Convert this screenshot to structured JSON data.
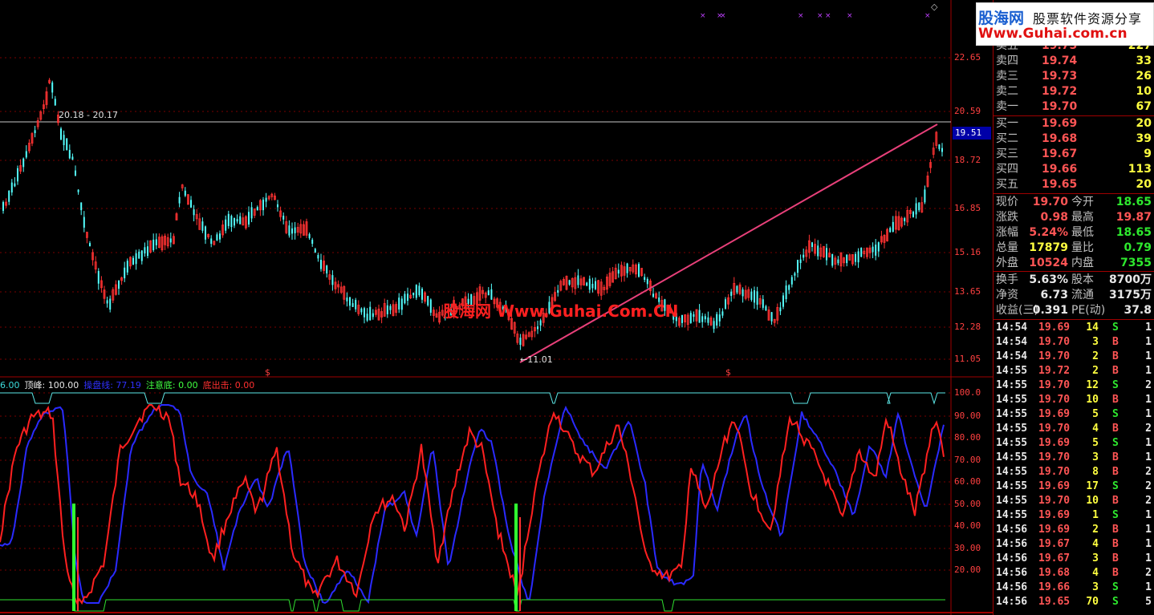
{
  "logo": {
    "brand": "股海网",
    "tagline": "股票软件资源分享",
    "url": "Www.Guhai.com.cn"
  },
  "watermark": "股海网 Www.Guhai.Com.CN",
  "main_chart": {
    "y_labels": [
      "22.65",
      "20.59",
      "18.72",
      "16.85",
      "15.16",
      "13.65",
      "12.28",
      "11.05"
    ],
    "high_annotation": "20.18 - 20.17",
    "low_annotation": "11.01",
    "current_price_tag": "19.51"
  },
  "indicator": {
    "header": [
      {
        "text": "6.00",
        "color": "#3cdcdc"
      },
      {
        "text": "顶峰: 100.00",
        "color": "#e8e8e8"
      },
      {
        "text": "操盘线: 77.19",
        "color": "#3030ff"
      },
      {
        "text": "注意底: 0.00",
        "color": "#40ff40"
      },
      {
        "text": "底出击: 0.00",
        "color": "#ff3030"
      }
    ],
    "y_labels": [
      "100.0",
      "90.00",
      "80.00",
      "70.00",
      "60.00",
      "50.00",
      "40.00",
      "30.00",
      "20.00"
    ]
  },
  "order_book": {
    "asks": [
      {
        "label": "卖五",
        "price": "19.75",
        "vol": "227"
      },
      {
        "label": "卖四",
        "price": "19.74",
        "vol": "33"
      },
      {
        "label": "卖三",
        "price": "19.73",
        "vol": "26"
      },
      {
        "label": "卖二",
        "price": "19.72",
        "vol": "10"
      },
      {
        "label": "卖一",
        "price": "19.70",
        "vol": "67"
      }
    ],
    "bids": [
      {
        "label": "买一",
        "price": "19.69",
        "vol": "20"
      },
      {
        "label": "买二",
        "price": "19.68",
        "vol": "39"
      },
      {
        "label": "买三",
        "price": "19.67",
        "vol": "9"
      },
      {
        "label": "买四",
        "price": "19.66",
        "vol": "113"
      },
      {
        "label": "买五",
        "price": "19.65",
        "vol": "20"
      }
    ]
  },
  "quote": [
    {
      "l1": "现价",
      "v1": "19.70",
      "c1": "red",
      "l2": "今开",
      "v2": "18.65",
      "c2": "grn"
    },
    {
      "l1": "涨跌",
      "v1": "0.98",
      "c1": "red",
      "l2": "最高",
      "v2": "19.87",
      "c2": "red"
    },
    {
      "l1": "涨幅",
      "v1": "5.24%",
      "c1": "red",
      "l2": "最低",
      "v2": "18.65",
      "c2": "grn"
    },
    {
      "l1": "总量",
      "v1": "17879",
      "c1": "yel",
      "l2": "量比",
      "v2": "0.79",
      "c2": "grn"
    },
    {
      "l1": "外盘",
      "v1": "10524",
      "c1": "red",
      "l2": "内盘",
      "v2": "7355",
      "c2": "grn"
    }
  ],
  "fundamentals": [
    {
      "l1": "换手",
      "v1": "5.63%",
      "l2": "股本",
      "v2": "8700万"
    },
    {
      "l1": "净资",
      "v1": "6.73",
      "l2": "流通",
      "v2": "3175万"
    },
    {
      "l1": "收益(三)",
      "v1": "0.391",
      "l2": "PE(动)",
      "v2": "37.8"
    }
  ],
  "ticks": [
    {
      "time": "14:54",
      "price": "19.69",
      "vol": "14",
      "side": "S",
      "n": "1"
    },
    {
      "time": "14:54",
      "price": "19.70",
      "vol": "3",
      "side": "B",
      "n": "1"
    },
    {
      "time": "14:54",
      "price": "19.70",
      "vol": "2",
      "side": "B",
      "n": "1"
    },
    {
      "time": "14:55",
      "price": "19.72",
      "vol": "2",
      "side": "B",
      "n": "1"
    },
    {
      "time": "14:55",
      "price": "19.70",
      "vol": "12",
      "side": "S",
      "n": "2"
    },
    {
      "time": "14:55",
      "price": "19.70",
      "vol": "10",
      "side": "B",
      "n": "1"
    },
    {
      "time": "14:55",
      "price": "19.69",
      "vol": "5",
      "side": "S",
      "n": "1"
    },
    {
      "time": "14:55",
      "price": "19.70",
      "vol": "4",
      "side": "B",
      "n": "2"
    },
    {
      "time": "14:55",
      "price": "19.69",
      "vol": "5",
      "side": "S",
      "n": "1"
    },
    {
      "time": "14:55",
      "price": "19.70",
      "vol": "3",
      "side": "B",
      "n": "1"
    },
    {
      "time": "14:55",
      "price": "19.70",
      "vol": "8",
      "side": "B",
      "n": "2"
    },
    {
      "time": "14:55",
      "price": "19.69",
      "vol": "17",
      "side": "S",
      "n": "2"
    },
    {
      "time": "14:55",
      "price": "19.70",
      "vol": "10",
      "side": "B",
      "n": "2"
    },
    {
      "time": "14:55",
      "price": "19.69",
      "vol": "1",
      "side": "S",
      "n": "1"
    },
    {
      "time": "14:56",
      "price": "19.69",
      "vol": "2",
      "side": "B",
      "n": "1"
    },
    {
      "time": "14:56",
      "price": "19.67",
      "vol": "4",
      "side": "B",
      "n": "1"
    },
    {
      "time": "14:56",
      "price": "19.67",
      "vol": "3",
      "side": "B",
      "n": "1"
    },
    {
      "time": "14:56",
      "price": "19.68",
      "vol": "4",
      "side": "B",
      "n": "2"
    },
    {
      "time": "14:56",
      "price": "19.66",
      "vol": "3",
      "side": "S",
      "n": "1"
    },
    {
      "time": "14:56",
      "price": "19.65",
      "vol": "70",
      "side": "S",
      "n": "5"
    }
  ]
}
